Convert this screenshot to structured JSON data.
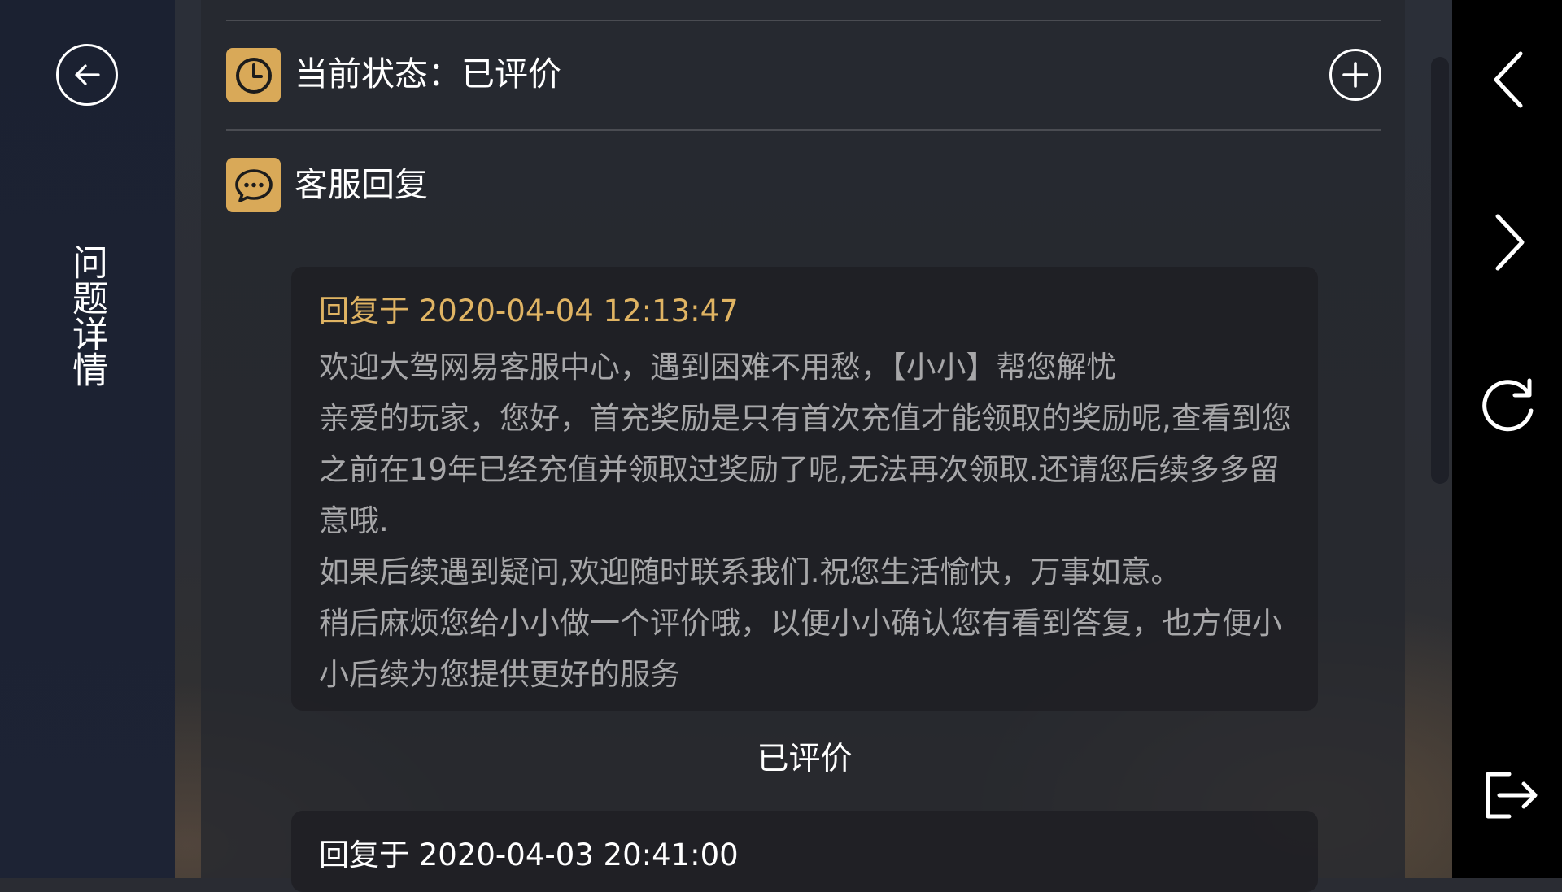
{
  "sidebar": {
    "title": "问题详情",
    "back_icon": "arrow-left-circle-icon"
  },
  "header": {
    "status_text": "当前状态：已评价",
    "status_icon": "clock-icon",
    "add_icon": "plus-circle-icon"
  },
  "reply_section": {
    "title": "客服回复",
    "icon": "chat-bubble-icon"
  },
  "replies": [
    {
      "date": "回复于 2020-04-04 12:13:47",
      "paragraphs": [
        "欢迎大驾网易客服中心，遇到困难不用愁，【小小】帮您解忧",
        "亲爱的玩家，您好，首充奖励是只有首次充值才能领取的奖励呢,查看到您之前在19年已经充值并领取过奖励了呢,无法再次领取.还请您后续多多留意哦.",
        "如果后续遇到疑问,欢迎随时联系我们.祝您生活愉快，万事如意。",
        "稍后麻烦您给小小做一个评价哦，以便小小确认您有看到答复，也方便小小后续为您提供更好的服务"
      ],
      "rating_status": "已评价"
    },
    {
      "date": "回复于 2020-04-03 20:41:00"
    }
  ],
  "right_nav": {
    "back_icon": "chevron-left-icon",
    "forward_icon": "chevron-right-icon",
    "refresh_icon": "refresh-icon",
    "exit_icon": "exit-icon"
  },
  "colors": {
    "accent": "#d9a958",
    "date_highlight": "#e0b463",
    "body_text": "#a7a7a9"
  }
}
